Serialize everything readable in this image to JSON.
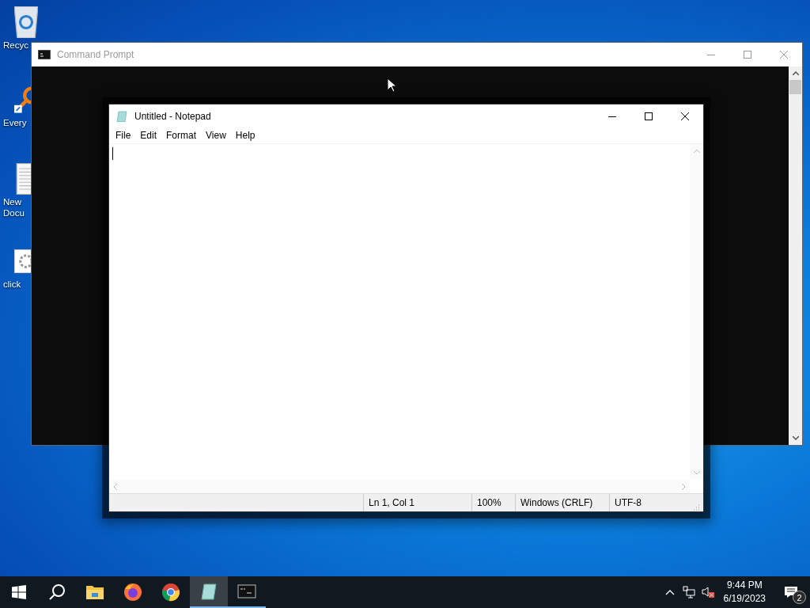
{
  "desktop_icons": [
    {
      "kind": "recycle",
      "lines": [
        "Recyc"
      ]
    },
    {
      "kind": "search-app",
      "lines": [
        "Every"
      ]
    },
    {
      "kind": "document",
      "lines": [
        "New",
        "Docu"
      ]
    },
    {
      "kind": "settings-file",
      "lines": [
        "click"
      ]
    }
  ],
  "command_prompt": {
    "title": "Command Prompt",
    "focused": false
  },
  "notepad": {
    "title": "Untitled - Notepad",
    "focused": true,
    "menu": [
      "File",
      "Edit",
      "Format",
      "View",
      "Help"
    ],
    "status_bar": [
      "Ln 1, Col 1",
      "100%",
      "Windows (CRLF)",
      "UTF-8"
    ]
  },
  "taskbar": {
    "apps": [
      {
        "kind": "explorer",
        "running": false,
        "selected": false
      },
      {
        "kind": "firefox",
        "running": false,
        "selected": false
      },
      {
        "kind": "chrome",
        "running": false,
        "selected": false
      },
      {
        "kind": "notepad",
        "running": true,
        "selected": true
      },
      {
        "kind": "console",
        "running": true,
        "selected": false
      }
    ],
    "time": "9:44 PM",
    "date": "6/19/2023",
    "notification_count": "2"
  }
}
